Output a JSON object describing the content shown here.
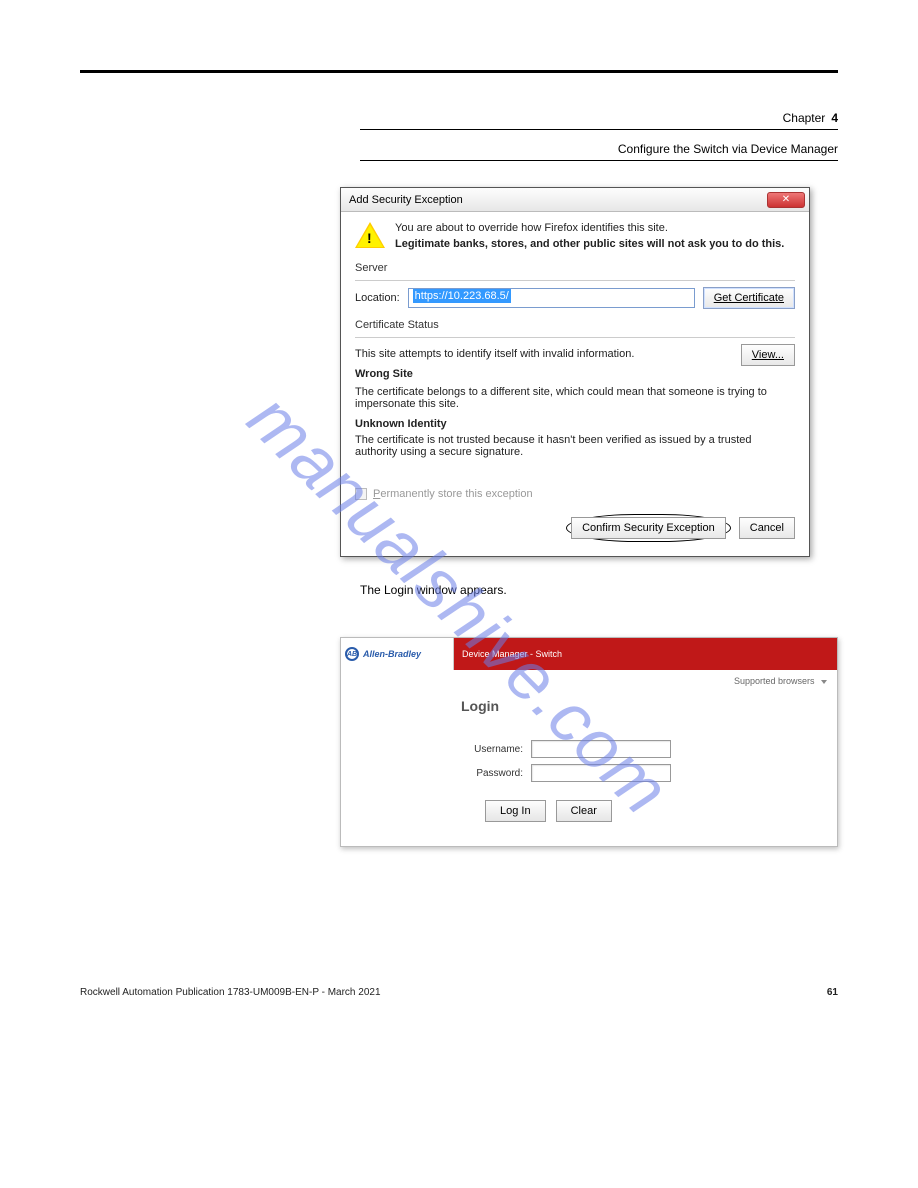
{
  "chapter": {
    "label": "Chapter",
    "number": "4"
  },
  "section_title": "Configure the Switch via Device Manager",
  "dialog": {
    "title": "Add Security Exception",
    "warn_line1": "You are about to override how Firefox identifies this site.",
    "warn_line2": "Legitimate banks, stores, and other public sites will not ask you to do this.",
    "server_label": "Server",
    "location_label": "Location:",
    "location_value": "https://10.223.68.5/",
    "get_cert": "Get Certificate",
    "cert_status_label": "Certificate Status",
    "cert_status_text": "This site attempts to identify itself with invalid information.",
    "view": "View...",
    "wrong_site_heading": "Wrong Site",
    "wrong_site_text": "The certificate belongs to a different site, which could mean that someone is trying to impersonate this site.",
    "unknown_heading": "Unknown Identity",
    "unknown_text": "The certificate is not trusted because it hasn't been verified as issued by a trusted authority using a secure signature.",
    "perm_store": "Permanently store this exception",
    "confirm": "Confirm Security Exception",
    "cancel": "Cancel"
  },
  "login": {
    "step_text": "The Login window appears.",
    "brand": "Allen-Bradley",
    "brand_badge": "AB",
    "bar_label": "Device Manager - Switch",
    "supported": "Supported browsers",
    "title": "Login",
    "username_label": "Username:",
    "password_label": "Password:",
    "login_btn": "Log In",
    "clear_btn": "Clear"
  },
  "footer": {
    "left": "Rockwell Automation Publication 1783-UM009B-EN-P - March 2021",
    "right": "61"
  },
  "watermark": "manualshive.com"
}
